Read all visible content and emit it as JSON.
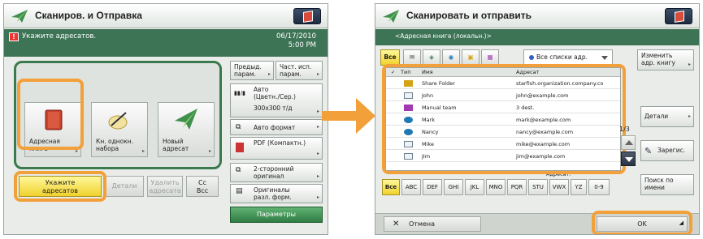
{
  "left": {
    "title": "Сканиров. и Отправка",
    "warning": "Укажите адресатов.",
    "date": "06/17/2010",
    "time": "5:00 PM",
    "tiles": [
      {
        "label_l1": "Адресная",
        "label_l2": "книга"
      },
      {
        "label_l1": "Кн. однокн.",
        "label_l2": "набора"
      },
      {
        "label_l1": "Новый",
        "label_l2": "адресат"
      }
    ],
    "side": {
      "pref_l1": "Предыд.",
      "pref_l2": "парам.",
      "often_l1": "Част. исп.",
      "often_l2": "парам.",
      "color_l1": "Авто",
      "color_l2": "(Цветн./Сер.)",
      "resolution": "300x300 т/д",
      "size": "Авто формат",
      "format_l1": "PDF (Компактн.)",
      "duplex_l1": "2-сторонний",
      "duplex_l2": "оригинал",
      "mixed_l1": "Оригиналы",
      "mixed_l2": "разл. форм.",
      "options": "Параметры"
    },
    "bottom": {
      "specify_l1": "Укажите",
      "specify_l2": "адресатов",
      "details": "Детали",
      "delete_l1": "Удалить",
      "delete_l2": "адресата",
      "ccbcc_l1": "Cc",
      "ccbcc_l2": "Bcc"
    }
  },
  "right": {
    "title": "Сканировать и отправить",
    "subtitle": "<Адресная книга (локальн.)>",
    "all_label": "Все",
    "dropdown": "Все списки адр.",
    "change_l1": "Изменить",
    "change_l2": "адр. книгу",
    "columns": {
      "type": "Тип",
      "name": "Имя",
      "address": "Адресат"
    },
    "rows": [
      {
        "icon": "folder",
        "name": "Share Folder",
        "address": "starfish.organization.company.co"
      },
      {
        "icon": "email",
        "name": "John",
        "address": "john@example.com"
      },
      {
        "icon": "group",
        "name": "Manual team",
        "address": "3 dest."
      },
      {
        "icon": "fax",
        "name": "Mark",
        "address": "mark@example.com"
      },
      {
        "icon": "fax",
        "name": "Nancy",
        "address": "nancy@example.com"
      },
      {
        "icon": "email",
        "name": "Mike",
        "address": "mike@example.com"
      },
      {
        "icon": "email",
        "name": "Jim",
        "address": "jim@example.com"
      }
    ],
    "footer": "Адресат:",
    "page": "1/3",
    "details": "Детали",
    "register": "Зарегис.",
    "search_l1": "Поиск по",
    "search_l2": "имени",
    "alphabet": [
      "Все",
      "ABC",
      "DEF",
      "GHI",
      "JKL",
      "MNO",
      "PQR",
      "STU",
      "VWX",
      "YZ",
      "0-9"
    ],
    "cancel": "Отмена",
    "ok": "OK"
  },
  "colors": {
    "accent_orange": "#f2a03a",
    "header_green": "#3e7456",
    "selection_yellow": "#f0d22e"
  }
}
